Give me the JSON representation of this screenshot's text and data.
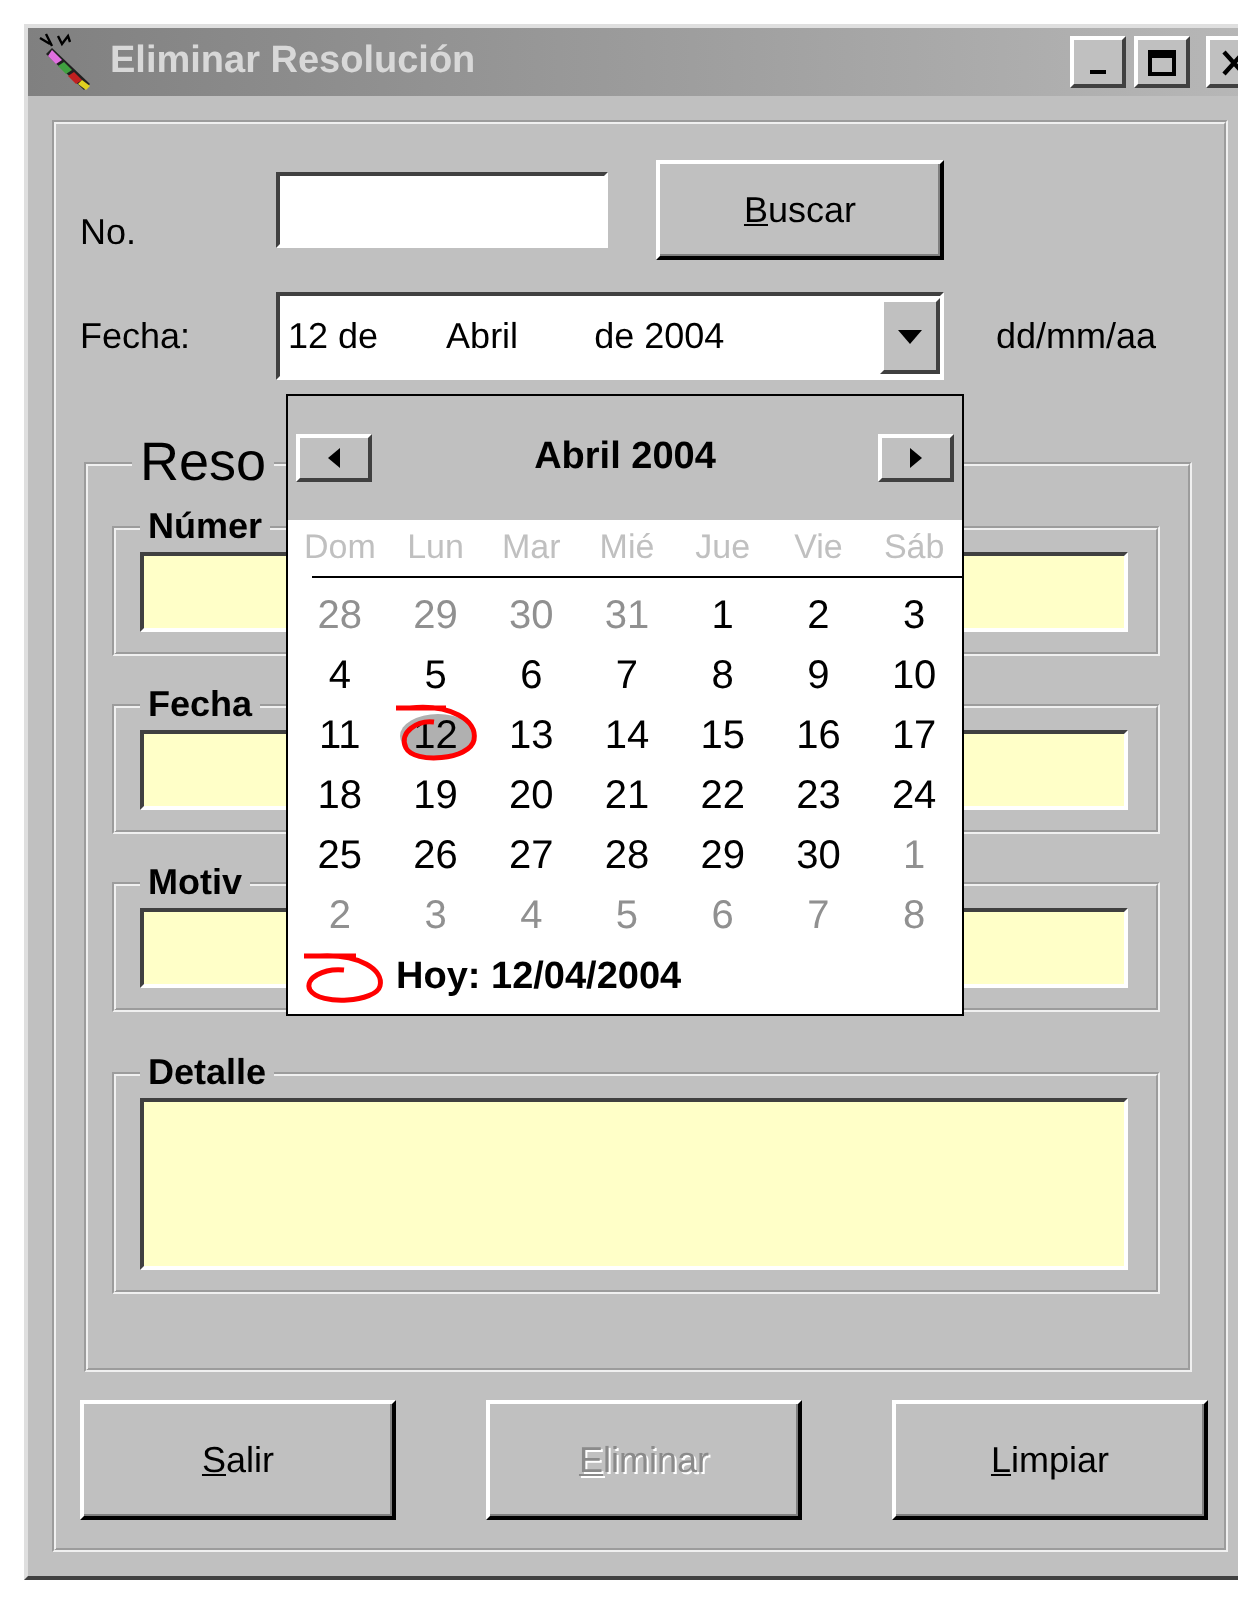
{
  "window": {
    "title": "Eliminar Resolución"
  },
  "search": {
    "label": "No.",
    "button": {
      "label": "Buscar",
      "mnemonic": true
    }
  },
  "date": {
    "label": "Fecha:",
    "value_parts": [
      "12 de",
      "Abril",
      "de 2004"
    ],
    "hint": "dd/mm/aa"
  },
  "calendar": {
    "title": "Abril 2004",
    "weekdays": [
      "Dom",
      "Lun",
      "Mar",
      "Mié",
      "Jue",
      "Vie",
      "Sáb"
    ],
    "weeks": [
      [
        {
          "day": "28",
          "muted": true,
          "selected": false,
          "today": false
        },
        {
          "day": "29",
          "muted": true,
          "selected": false,
          "today": false
        },
        {
          "day": "30",
          "muted": true,
          "selected": false,
          "today": false
        },
        {
          "day": "31",
          "muted": true,
          "selected": false,
          "today": false
        },
        {
          "day": "1",
          "muted": false,
          "selected": false,
          "today": false
        },
        {
          "day": "2",
          "muted": false,
          "selected": false,
          "today": false
        },
        {
          "day": "3",
          "muted": false,
          "selected": false,
          "today": false
        }
      ],
      [
        {
          "day": "4",
          "muted": false,
          "selected": false,
          "today": false
        },
        {
          "day": "5",
          "muted": false,
          "selected": false,
          "today": false
        },
        {
          "day": "6",
          "muted": false,
          "selected": false,
          "today": false
        },
        {
          "day": "7",
          "muted": false,
          "selected": false,
          "today": false
        },
        {
          "day": "8",
          "muted": false,
          "selected": false,
          "today": false
        },
        {
          "day": "9",
          "muted": false,
          "selected": false,
          "today": false
        },
        {
          "day": "10",
          "muted": false,
          "selected": false,
          "today": false
        }
      ],
      [
        {
          "day": "11",
          "muted": false,
          "selected": false,
          "today": false
        },
        {
          "day": "12",
          "muted": false,
          "selected": true,
          "today": true
        },
        {
          "day": "13",
          "muted": false,
          "selected": false,
          "today": false
        },
        {
          "day": "14",
          "muted": false,
          "selected": false,
          "today": false
        },
        {
          "day": "15",
          "muted": false,
          "selected": false,
          "today": false
        },
        {
          "day": "16",
          "muted": false,
          "selected": false,
          "today": false
        },
        {
          "day": "17",
          "muted": false,
          "selected": false,
          "today": false
        }
      ],
      [
        {
          "day": "18",
          "muted": false,
          "selected": false,
          "today": false
        },
        {
          "day": "19",
          "muted": false,
          "selected": false,
          "today": false
        },
        {
          "day": "20",
          "muted": false,
          "selected": false,
          "today": false
        },
        {
          "day": "21",
          "muted": false,
          "selected": false,
          "today": false
        },
        {
          "day": "22",
          "muted": false,
          "selected": false,
          "today": false
        },
        {
          "day": "23",
          "muted": false,
          "selected": false,
          "today": false
        },
        {
          "day": "24",
          "muted": false,
          "selected": false,
          "today": false
        }
      ],
      [
        {
          "day": "25",
          "muted": false,
          "selected": false,
          "today": false
        },
        {
          "day": "26",
          "muted": false,
          "selected": false,
          "today": false
        },
        {
          "day": "27",
          "muted": false,
          "selected": false,
          "today": false
        },
        {
          "day": "28",
          "muted": false,
          "selected": false,
          "today": false
        },
        {
          "day": "29",
          "muted": false,
          "selected": false,
          "today": false
        },
        {
          "day": "30",
          "muted": false,
          "selected": false,
          "today": false
        },
        {
          "day": "1",
          "muted": true,
          "selected": false,
          "today": false
        }
      ],
      [
        {
          "day": "2",
          "muted": true,
          "selected": false,
          "today": false
        },
        {
          "day": "3",
          "muted": true,
          "selected": false,
          "today": false
        },
        {
          "day": "4",
          "muted": true,
          "selected": false,
          "today": false
        },
        {
          "day": "5",
          "muted": true,
          "selected": false,
          "today": false
        },
        {
          "day": "6",
          "muted": true,
          "selected": false,
          "today": false
        },
        {
          "day": "7",
          "muted": true,
          "selected": false,
          "today": false
        },
        {
          "day": "8",
          "muted": true,
          "selected": false,
          "today": false
        }
      ]
    ],
    "today_label": "Hoy: 12/04/2004"
  },
  "group": {
    "title": "Reso",
    "fields": [
      {
        "label": "Númer",
        "kind": "single"
      },
      {
        "label": "Fecha",
        "kind": "single"
      },
      {
        "label": "Motiv",
        "kind": "single"
      },
      {
        "label": "Detalle",
        "kind": "multiline"
      }
    ]
  },
  "buttons": [
    {
      "label": "Salir",
      "mnemonic": true,
      "disabled": false
    },
    {
      "label": "Eliminar",
      "mnemonic": true,
      "disabled": true
    },
    {
      "label": "Limpiar",
      "mnemonic": true,
      "disabled": false
    }
  ]
}
